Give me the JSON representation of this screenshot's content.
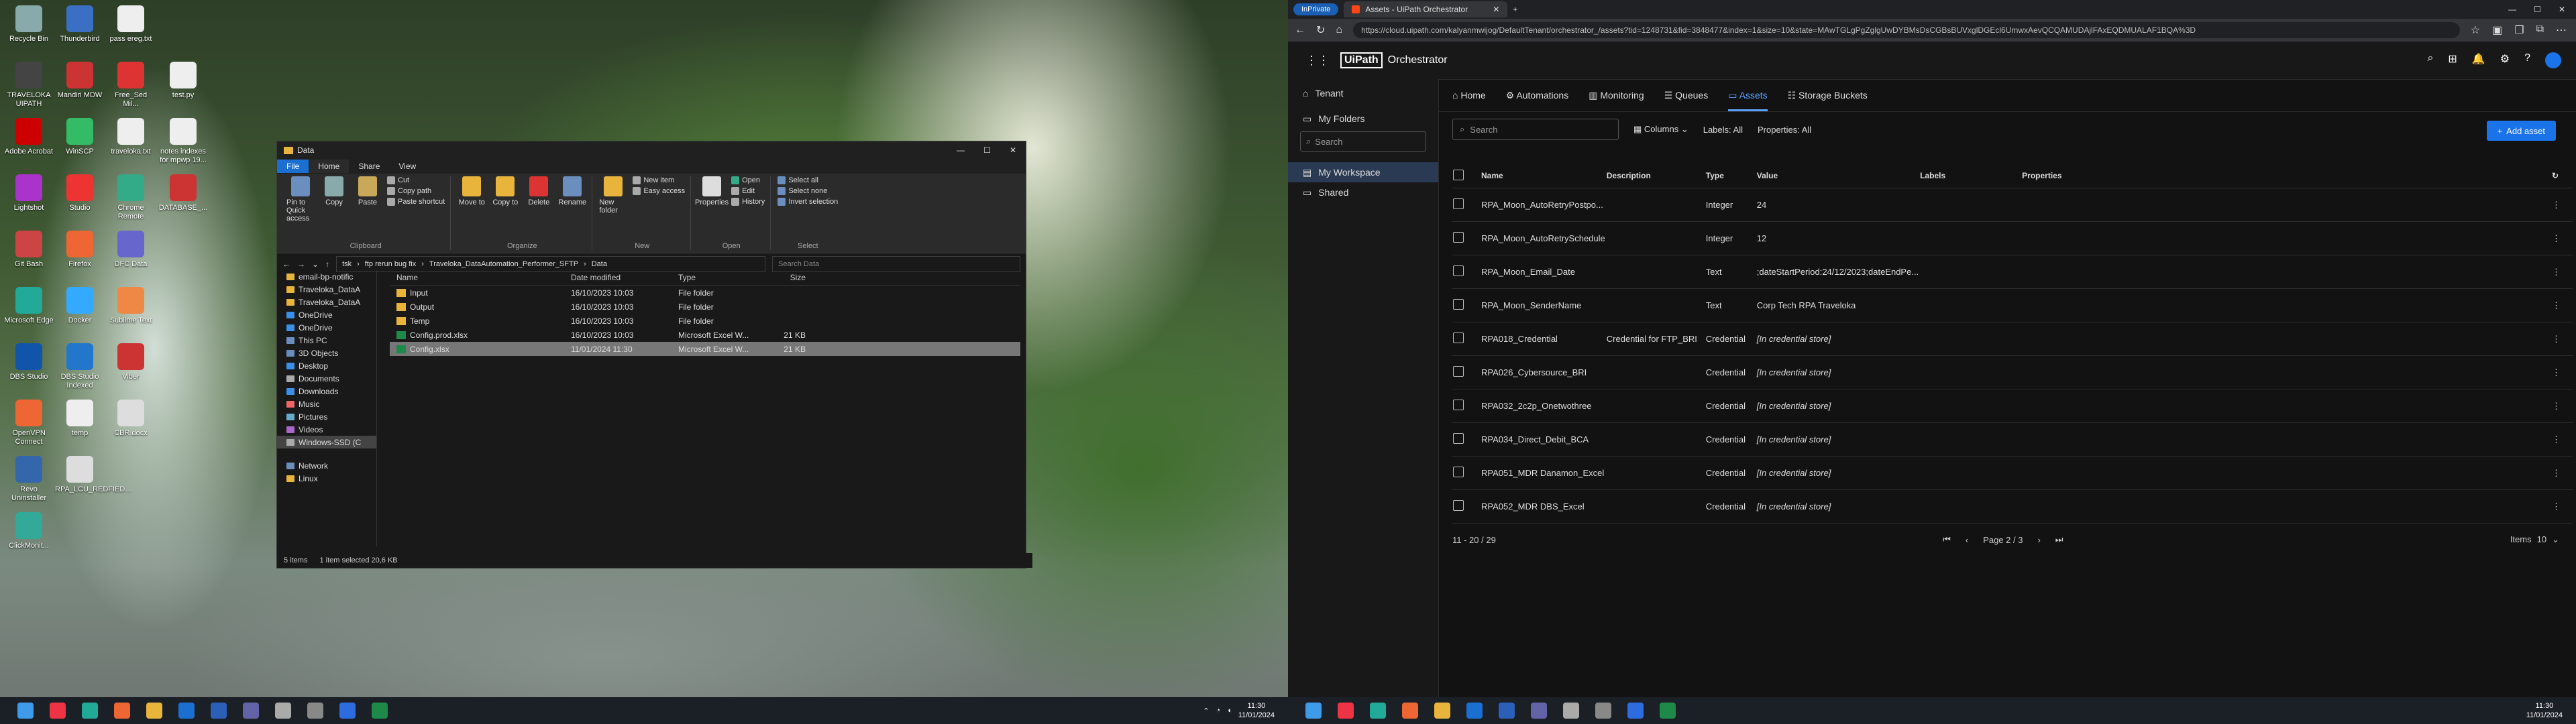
{
  "desktop": {
    "icons": [
      {
        "label": "Recycle Bin",
        "color": "#8aa"
      },
      {
        "label": "Thunderbird",
        "color": "#3a6fc4"
      },
      {
        "label": "pass ereg.txt",
        "color": "#eee"
      },
      {
        "label": "TRAVELOKA UIPATH",
        "color": "#444"
      },
      {
        "label": "Mandiri MDW",
        "color": "#c33"
      },
      {
        "label": "Free_Sed Mil...",
        "color": "#d33"
      },
      {
        "label": "test.py",
        "color": "#eee"
      },
      {
        "label": "Adobe Acrobat",
        "color": "#c00"
      },
      {
        "label": "WinSCP",
        "color": "#3b6"
      },
      {
        "label": "traveloka.txt",
        "color": "#eee"
      },
      {
        "label": "notes indexes for mpwp 19...",
        "color": "#eee"
      },
      {
        "label": "Lightshot",
        "color": "#a3c"
      },
      {
        "label": "Studio",
        "color": "#e33"
      },
      {
        "label": "Chrome Remote",
        "color": "#3a8"
      },
      {
        "label": "DATABASE_...",
        "color": "#c33"
      },
      {
        "label": "Git Bash",
        "color": "#c44"
      },
      {
        "label": "Firefox",
        "color": "#e63"
      },
      {
        "label": "DFC Data",
        "color": "#66c"
      },
      {
        "label": "Microsoft Edge",
        "color": "#2a9"
      },
      {
        "label": "Docker",
        "color": "#3af"
      },
      {
        "label": "Sublime Text",
        "color": "#e84"
      },
      {
        "label": "DBS Studio",
        "color": "#15a"
      },
      {
        "label": "DBS Studio Indexed",
        "color": "#27c"
      },
      {
        "label": "Viber",
        "color": "#c33"
      },
      {
        "label": "OpenVPN Connect",
        "color": "#e63"
      },
      {
        "label": "temp",
        "color": "#eee"
      },
      {
        "label": "CBR.docx",
        "color": "#ddd"
      },
      {
        "label": "Revo Uninstaller",
        "color": "#36a"
      },
      {
        "label": "RPA_LCU_REDFIED...",
        "color": "#ddd"
      },
      {
        "label": "ClickMonit...",
        "color": "#3a9"
      }
    ]
  },
  "explorer": {
    "title": "Data",
    "menu": [
      "File",
      "Home",
      "Share",
      "View"
    ],
    "ribbon": {
      "clipboard": {
        "label": "Clipboard",
        "pin": "Pin to Quick access",
        "copy": "Copy",
        "paste": "Paste",
        "cut": "Cut",
        "copy_path": "Copy path",
        "paste_shortcut": "Paste shortcut"
      },
      "organize": {
        "label": "Organize",
        "move": "Move to",
        "copyto": "Copy to",
        "delete": "Delete",
        "rename": "Rename"
      },
      "new": {
        "label": "New",
        "folder": "New folder",
        "item": "New item",
        "easy": "Easy access"
      },
      "open": {
        "label": "Open",
        "properties": "Properties",
        "open": "Open",
        "edit": "Edit",
        "history": "History"
      },
      "select": {
        "label": "Select",
        "all": "Select all",
        "none": "Select none",
        "invert": "Invert selection"
      }
    },
    "path": [
      "tsk",
      "ftp rerun bug fix",
      "Traveloka_DataAutomation_Performer_SFTP",
      "Data"
    ],
    "search_placeholder": "Search Data",
    "nav": [
      {
        "label": "email-bp-notific"
      },
      {
        "label": "Traveloka_DataA"
      },
      {
        "label": "Traveloka_DataA"
      },
      {
        "label": "OneDrive"
      },
      {
        "label": "OneDrive"
      },
      {
        "label": "This PC"
      },
      {
        "label": "3D Objects"
      },
      {
        "label": "Desktop"
      },
      {
        "label": "Documents"
      },
      {
        "label": "Downloads"
      },
      {
        "label": "Music"
      },
      {
        "label": "Pictures"
      },
      {
        "label": "Videos"
      },
      {
        "label": "Windows-SSD (C"
      },
      {
        "label": "Network"
      },
      {
        "label": "Linux"
      }
    ],
    "columns": [
      "Name",
      "Date modified",
      "Type",
      "Size"
    ],
    "files": [
      {
        "name": "Input",
        "date": "16/10/2023 10:03",
        "type": "File folder",
        "size": ""
      },
      {
        "name": "Output",
        "date": "16/10/2023 10:03",
        "type": "File folder",
        "size": ""
      },
      {
        "name": "Temp",
        "date": "16/10/2023 10:03",
        "type": "File folder",
        "size": ""
      },
      {
        "name": "Config.prod.xlsx",
        "date": "16/10/2023 10:03",
        "type": "Microsoft Excel W...",
        "size": "21 KB"
      },
      {
        "name": "Config.xlsx",
        "date": "11/01/2024 11:30",
        "type": "Microsoft Excel W...",
        "size": "21 KB"
      }
    ],
    "status_items": "5 items",
    "status_selected": "1 item selected  20,6 KB"
  },
  "taskbar_left": {
    "time": "11:30",
    "date": "11/01/2024"
  },
  "taskbar_right": {
    "time": "11:30",
    "date": "11/01/2024"
  },
  "browser": {
    "inprivate": "InPrivate",
    "tab_title": "Assets - UiPath Orchestrator",
    "url": "https://cloud.uipath.com/kalyanmwijog/DefaultTenant/orchestrator_/assets?tid=1248731&fid=3848477&index=1&size=10&state=MAwTGLgPgZglgUwDYBMsDsCGBsBUVxglDGEcl6UmwxAevQCQAMUDAjlFAxEQDMUALAF1BQA%3D"
  },
  "orchestrator": {
    "brand": "UiPath",
    "product": "Orchestrator",
    "sidebar": {
      "tenant": "Tenant",
      "my_folders": "My Folders",
      "search": "Search",
      "my_workspace": "My Workspace",
      "shared": "Shared"
    },
    "tabs": [
      "Home",
      "Automations",
      "Monitoring",
      "Queues",
      "Assets",
      "Storage Buckets"
    ],
    "search_placeholder": "Search",
    "columns_btn": "Columns",
    "labels_filter": "Labels: All",
    "properties_filter": "Properties: All",
    "add_asset": "Add asset",
    "table_headers": [
      "Name",
      "Description",
      "Type",
      "Value",
      "Labels",
      "Properties"
    ],
    "rows": [
      {
        "name": "RPA_Moon_AutoRetryPostpo...",
        "description": "",
        "type": "Integer",
        "value": "24"
      },
      {
        "name": "RPA_Moon_AutoRetrySchedule",
        "description": "",
        "type": "Integer",
        "value": "12"
      },
      {
        "name": "RPA_Moon_Email_Date",
        "description": "",
        "type": "Text",
        "value": ";dateStartPeriod:24/12/2023;dateEndPe..."
      },
      {
        "name": "RPA_Moon_SenderName",
        "description": "",
        "type": "Text",
        "value": "Corp Tech RPA Traveloka"
      },
      {
        "name": "RPA018_Credential",
        "description": "Credential for FTP_BRI",
        "type": "Credential",
        "value": "[In credential store]"
      },
      {
        "name": "RPA026_Cybersource_BRI",
        "description": "",
        "type": "Credential",
        "value": "[In credential store]"
      },
      {
        "name": "RPA032_2c2p_Onetwothree",
        "description": "",
        "type": "Credential",
        "value": "[In credential store]"
      },
      {
        "name": "RPA034_Direct_Debit_BCA",
        "description": "",
        "type": "Credential",
        "value": "[In credential store]"
      },
      {
        "name": "RPA051_MDR Danamon_Excel",
        "description": "",
        "type": "Credential",
        "value": "[In credential store]"
      },
      {
        "name": "RPA052_MDR DBS_Excel",
        "description": "",
        "type": "Credential",
        "value": "[In credential store]"
      }
    ],
    "pager": {
      "range": "11 - 20 / 29",
      "page": "Page 2 / 3",
      "items_label": "Items",
      "items_value": "10"
    }
  }
}
